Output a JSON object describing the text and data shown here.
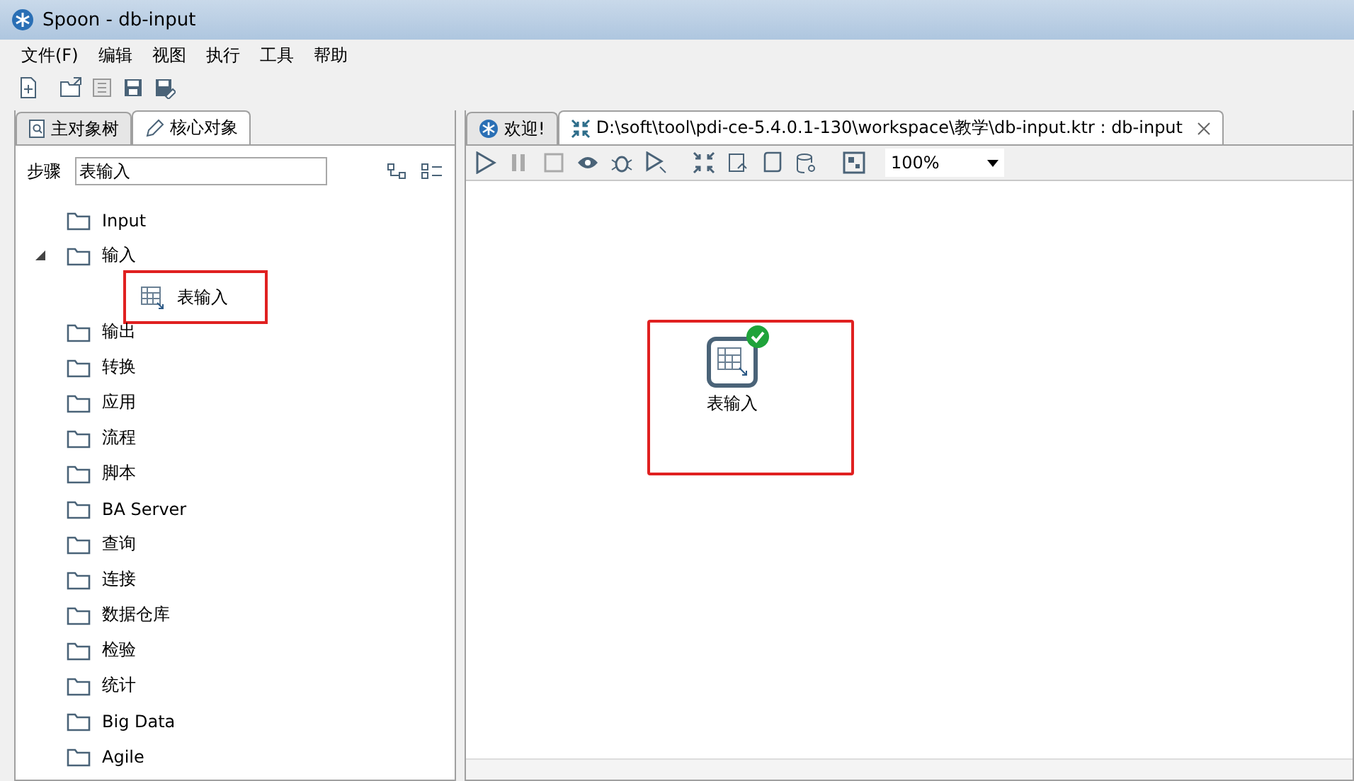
{
  "window": {
    "title": "Spoon - db-input"
  },
  "menu": [
    {
      "label": "文件(F)"
    },
    {
      "label": "编辑"
    },
    {
      "label": "视图"
    },
    {
      "label": "执行"
    },
    {
      "label": "工具"
    },
    {
      "label": "帮助"
    }
  ],
  "left_tabs": [
    {
      "label": "主对象树",
      "selected": false,
      "kind": "tree"
    },
    {
      "label": "核心对象",
      "selected": true,
      "kind": "pencil"
    }
  ],
  "search": {
    "label": "步骤",
    "value": "表输入"
  },
  "tree": [
    {
      "label": "Input",
      "kind": "folder",
      "expanded": false
    },
    {
      "label": "输入",
      "kind": "folder",
      "expanded": true,
      "children": [
        {
          "label": "表输入",
          "kind": "step",
          "highlighted": true
        }
      ]
    },
    {
      "label": "输出",
      "kind": "folder",
      "expanded": false
    },
    {
      "label": "转换",
      "kind": "folder",
      "expanded": false
    },
    {
      "label": "应用",
      "kind": "folder",
      "expanded": false
    },
    {
      "label": "流程",
      "kind": "folder",
      "expanded": false
    },
    {
      "label": "脚本",
      "kind": "folder",
      "expanded": false
    },
    {
      "label": "BA Server",
      "kind": "folder",
      "expanded": false
    },
    {
      "label": "查询",
      "kind": "folder",
      "expanded": false
    },
    {
      "label": "连接",
      "kind": "folder",
      "expanded": false
    },
    {
      "label": "数据仓库",
      "kind": "folder",
      "expanded": false
    },
    {
      "label": "检验",
      "kind": "folder",
      "expanded": false
    },
    {
      "label": "统计",
      "kind": "folder",
      "expanded": false
    },
    {
      "label": "Big Data",
      "kind": "folder",
      "expanded": false
    },
    {
      "label": "Agile",
      "kind": "folder",
      "expanded": false
    }
  ],
  "editor_tabs": [
    {
      "label": "欢迎!",
      "selected": false,
      "kind": "welcome"
    },
    {
      "label": "D:\\soft\\tool\\pdi-ce-5.4.0.1-130\\workspace\\教学\\db-input.ktr : db-input",
      "selected": true,
      "kind": "transform",
      "closable": true
    }
  ],
  "zoom": {
    "value": "100%"
  },
  "canvas_steps": [
    {
      "label": "表输入",
      "valid": true,
      "highlighted": true
    }
  ]
}
